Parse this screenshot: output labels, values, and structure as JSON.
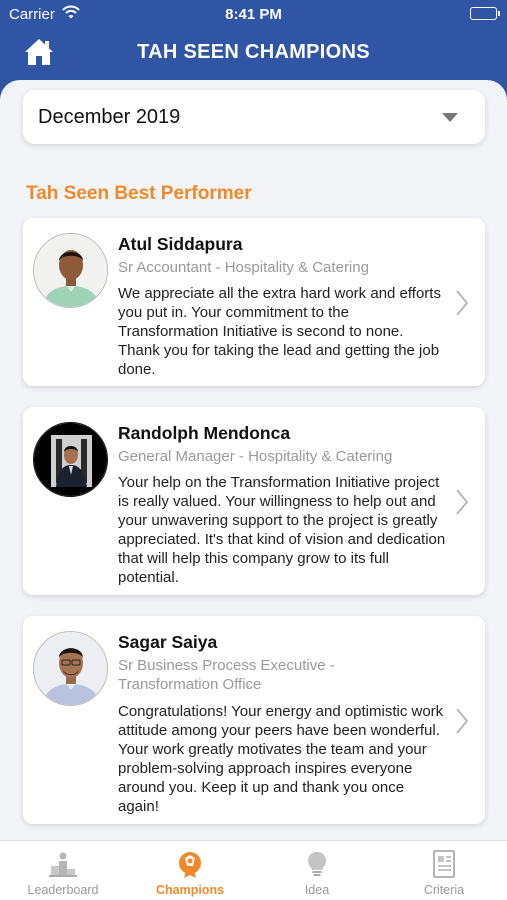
{
  "status_bar": {
    "carrier": "Carrier",
    "time": "8:41 PM"
  },
  "header": {
    "title": "TAH SEEN CHAMPIONS",
    "home_icon": "home-icon"
  },
  "month_select": {
    "value": "December 2019",
    "icon": "caret-down-icon"
  },
  "section_title": "Tah Seen Best Performer",
  "performers": [
    {
      "name": "Atul  Siddapura",
      "role": "Sr Accountant - Hospitality & Catering",
      "message": "We appreciate all the extra hard work and efforts you put in. Your commitment to the Transformation Initiative is second to none. Thank you for taking the lead and getting the job done."
    },
    {
      "name": "Randolph  Mendonca",
      "role": "General Manager - Hospitality & Catering",
      "message": "Your help on the Transformation Initiative project is really valued. Your willingness to help out and your unwavering support to the project is greatly appreciated. It's that kind of vision and dedication that will help this company grow to its full potential."
    },
    {
      "name": "Sagar Saiya",
      "role": "Sr Business Process Executive - Transformation Office",
      "message": "Congratulations! Your energy and optimistic work attitude among your peers have been wonderful. Your work greatly motivates the team and your problem-solving approach inspires everyone around you. Keep it up and thank you once again!"
    }
  ],
  "tabs": [
    {
      "label": "Leaderboard",
      "icon": "podium-icon",
      "active": false
    },
    {
      "label": "Champions",
      "icon": "champion-badge-icon",
      "active": true
    },
    {
      "label": "Idea",
      "icon": "lightbulb-icon",
      "active": false
    },
    {
      "label": "Criteria",
      "icon": "document-icon",
      "active": false
    }
  ],
  "colors": {
    "header_bg": "#2f55a4",
    "accent": "#f08a28",
    "sheet_bg": "#f3f4f7"
  }
}
